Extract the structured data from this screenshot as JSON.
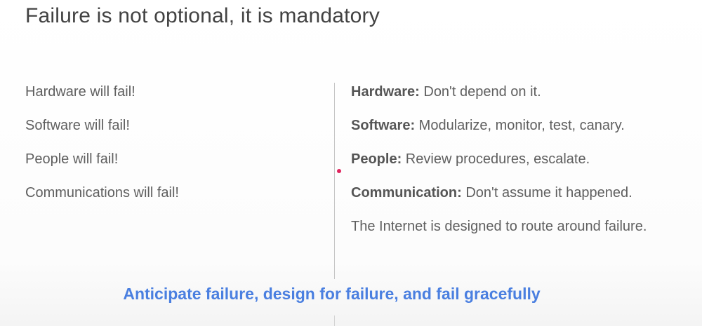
{
  "slide": {
    "title": "Failure is not optional, it is mandatory",
    "left_items": [
      "Hardware will fail!",
      "Software will fail!",
      "People will fail!",
      "Communications will fail!"
    ],
    "right_items": [
      {
        "key": "Hardware:",
        "text": " Don't depend on it."
      },
      {
        "key": "Software:",
        "text": " Modularize, monitor, test, canary."
      },
      {
        "key": "People:",
        "text": " Review procedures, escalate."
      },
      {
        "key": "Communication:",
        "text": " Don't assume it happened."
      },
      {
        "key": "",
        "text": "The Internet is designed to route around failure."
      }
    ],
    "callout": "Anticipate failure, design for failure, and fail gracefully"
  },
  "colors": {
    "callout": "#4a7fe0",
    "pointer": "#e0245e",
    "text": "#5f5f5f"
  }
}
